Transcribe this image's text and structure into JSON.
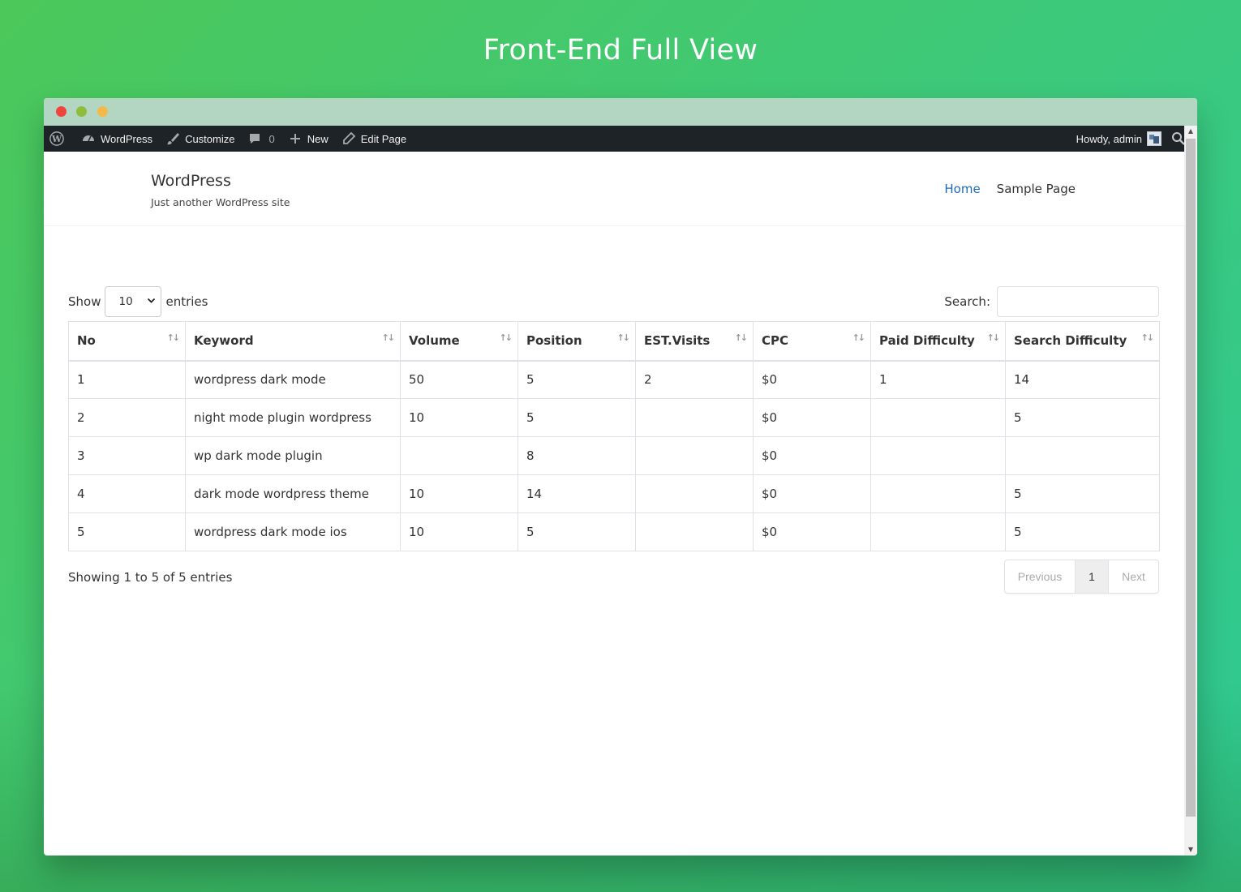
{
  "page_heading": "Front-End Full View",
  "admin_bar": {
    "site_name": "WordPress",
    "customize": "Customize",
    "comments_count": "0",
    "new": "New",
    "edit_page": "Edit Page",
    "howdy": "Howdy, admin"
  },
  "site": {
    "title": "WordPress",
    "tagline": "Just another WordPress site",
    "nav": [
      "Home",
      "Sample Page"
    ]
  },
  "table_controls": {
    "show_label": "Show",
    "entries_label": "entries",
    "page_length": "10",
    "search_label": "Search:"
  },
  "table": {
    "columns": [
      "No",
      "Keyword",
      "Volume",
      "Position",
      "EST.Visits",
      "CPC",
      "Paid Difficulty",
      "Search Difficulty"
    ],
    "rows": [
      [
        "1",
        "wordpress dark mode",
        "50",
        "5",
        "2",
        "$0",
        "1",
        "14"
      ],
      [
        "2",
        "night mode plugin wordpress",
        "10",
        "5",
        "",
        "$0",
        "",
        "5"
      ],
      [
        "3",
        "wp dark mode plugin",
        "",
        "8",
        "",
        "$0",
        "",
        ""
      ],
      [
        "4",
        "dark mode wordpress theme",
        "10",
        "14",
        "",
        "$0",
        "",
        "5"
      ],
      [
        "5",
        "wordpress dark mode ios",
        "10",
        "5",
        "",
        "$0",
        "",
        "5"
      ]
    ]
  },
  "table_footer": {
    "info": "Showing 1 to 5 of 5 entries",
    "previous": "Previous",
    "current_page": "1",
    "next": "Next"
  }
}
